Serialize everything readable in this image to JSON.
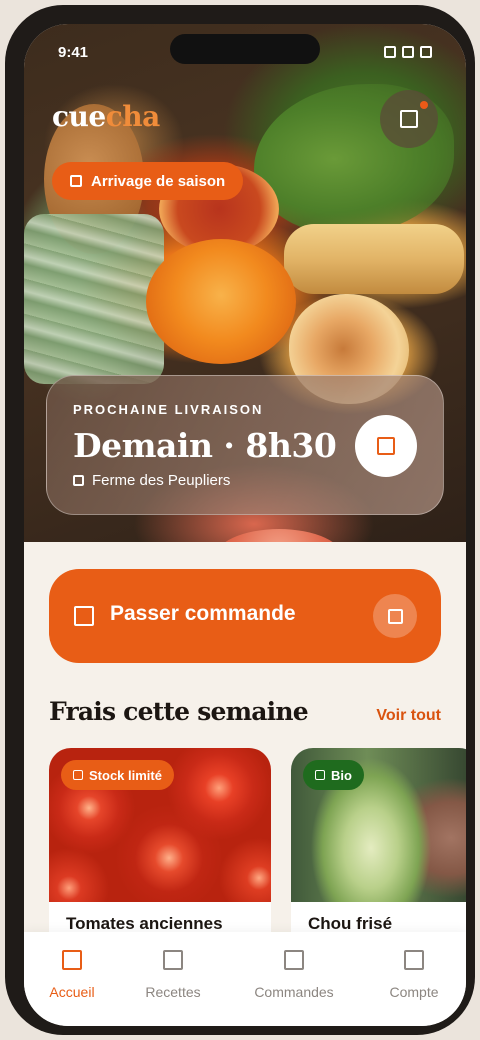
{
  "status_bar": {
    "time": "9:41",
    "icons": [
      "signal-icon",
      "wifi-icon",
      "battery-icon"
    ]
  },
  "brand": {
    "logo_part1": "cue",
    "logo_part2": "cha",
    "accent_color": "#e85d16"
  },
  "hero": {
    "season_chip": "Arrivage de saison",
    "delivery": {
      "label": "PROCHAINE LIVRAISON",
      "time": "Demain · 8h30",
      "farm": "Ferme des Peupliers"
    }
  },
  "cta": {
    "label": "Passer commande"
  },
  "section": {
    "title": "Frais cette semaine",
    "see_all": "Voir tout"
  },
  "products": [
    {
      "name": "Tomates anciennes",
      "badge": "Stock limité",
      "badge_color": "#e85d16"
    },
    {
      "name": "Chou frisé",
      "badge": "Bio",
      "badge_color": "#1f6b1e"
    }
  ],
  "tabs": [
    {
      "label": "Accueil",
      "active": true
    },
    {
      "label": "Recettes",
      "active": false
    },
    {
      "label": "Commandes",
      "active": false
    },
    {
      "label": "Compte",
      "active": false
    }
  ]
}
